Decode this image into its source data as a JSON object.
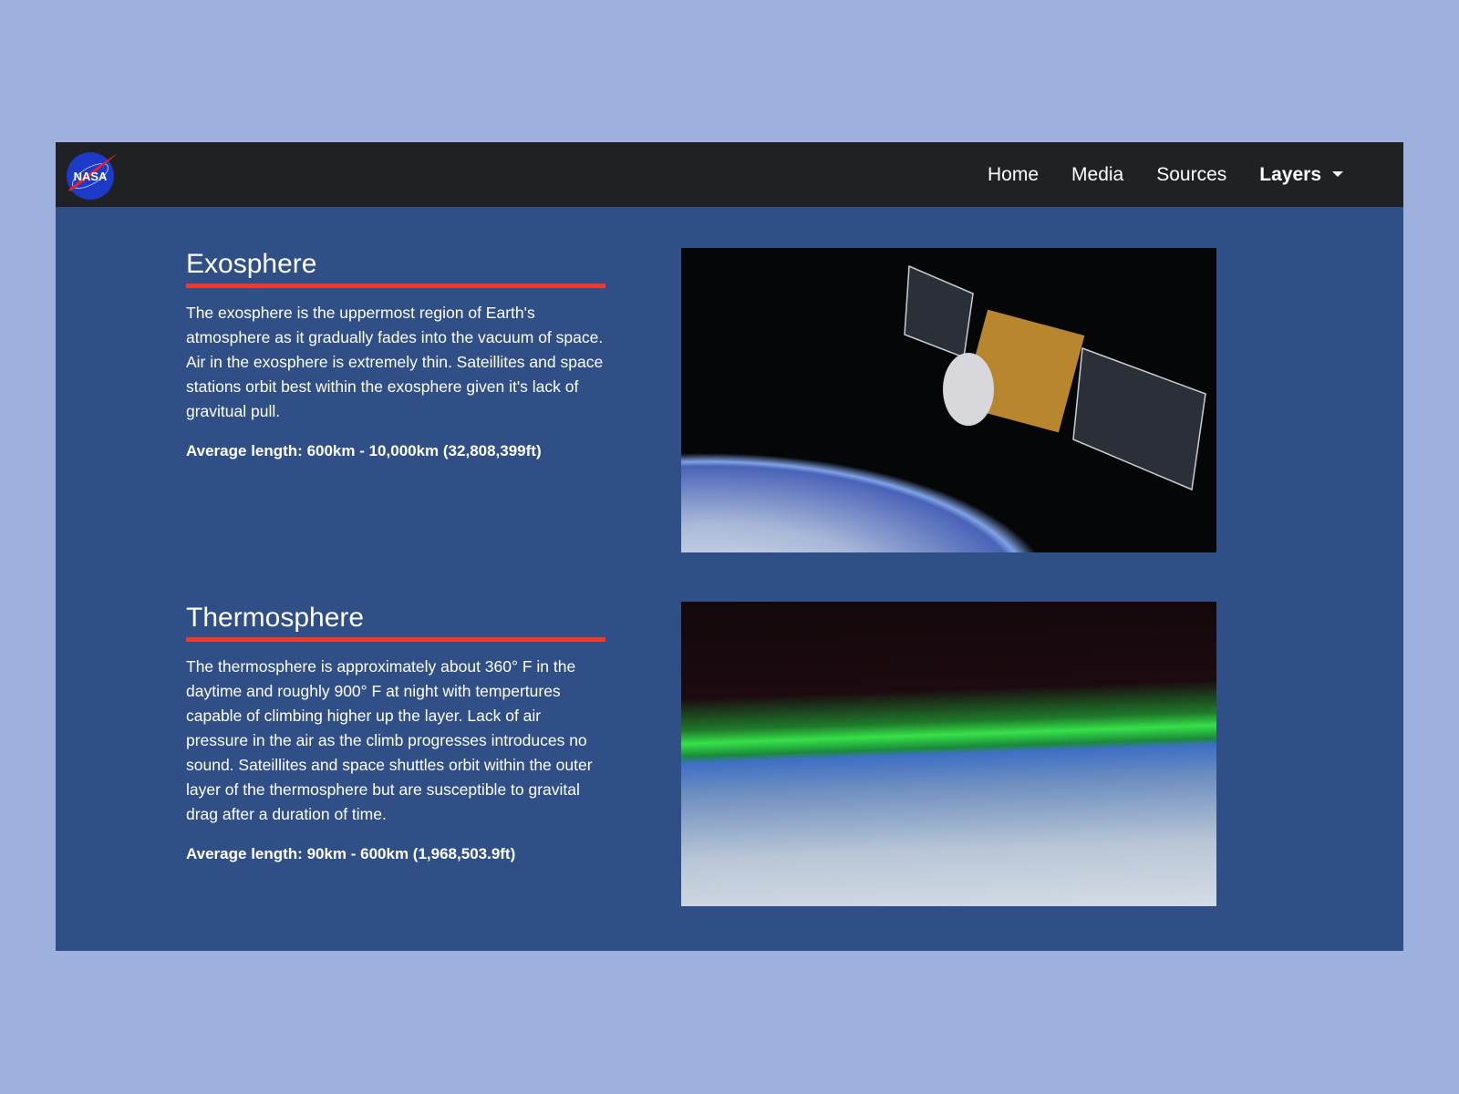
{
  "nav": {
    "logo_text": "NASA",
    "links": [
      {
        "label": "Home"
      },
      {
        "label": "Media"
      },
      {
        "label": "Sources"
      },
      {
        "label": "Layers",
        "active": true,
        "dropdown": true
      }
    ]
  },
  "sections": [
    {
      "title": "Exosphere",
      "body": "The exosphere is the uppermost region of Earth's atmosphere as it gradually fades into the vacuum of space. Air in the exosphere is extremely thin. Sateillites and space stations orbit best within the exosphere given it's lack of gravitual pull.",
      "length": "Average length: 600km - 10,000km (32,808,399ft)"
    },
    {
      "title": "Thermosphere",
      "body": "The thermosphere is approximately about 360° F in the daytime and roughly 900° F at night with tempertures capable of climbing higher up the layer. Lack of air pressure in the air as the climb progresses introduces no sound. Sateillites and space shuttles orbit within the outer layer of the thermosphere but are susceptible to gravital drag after a duration of time.",
      "length": "Average length: 90km - 600km (1,968,503.9ft)"
    }
  ],
  "colors": {
    "navbar": "#1f2124",
    "content": "#2f4f86",
    "accent": "#f0392b",
    "background": "#9eb1de"
  }
}
